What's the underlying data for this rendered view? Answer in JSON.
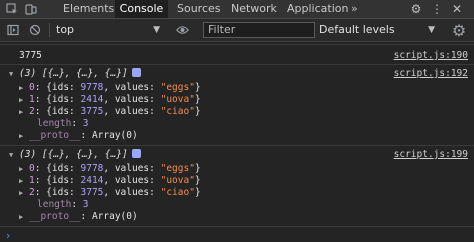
{
  "tabs": [
    "Elements",
    "Console",
    "Sources",
    "Network",
    "Application"
  ],
  "active_tab": "Console",
  "more_tabs_glyph": "»",
  "toolbar": {
    "context": "top",
    "filter_placeholder": "Filter",
    "levels": "Default levels"
  },
  "console": {
    "value_line": "3775",
    "value_source": "script.js:190",
    "groups": [
      {
        "summary": "(3) [{…}, {…}, {…}]",
        "source": "script.js:192",
        "items": [
          {
            "index": "0",
            "ids": "9778",
            "values": "\"eggs\""
          },
          {
            "index": "1",
            "ids": "2414",
            "values": "\"uova\""
          },
          {
            "index": "2",
            "ids": "3775",
            "values": "\"ciao\""
          }
        ],
        "length_key": "length",
        "length_val": "3",
        "proto_key": "__proto__",
        "proto_val": "Array(0)"
      },
      {
        "summary": "(3) [{…}, {…}, {…}]",
        "source": "script.js:199",
        "items": [
          {
            "index": "0",
            "ids": "9778",
            "values": "\"eggs\""
          },
          {
            "index": "1",
            "ids": "2414",
            "values": "\"uova\""
          },
          {
            "index": "2",
            "ids": "3775",
            "values": "\"ciao\""
          }
        ],
        "length_key": "length",
        "length_val": "3",
        "proto_key": "__proto__",
        "proto_val": "Array(0)"
      }
    ],
    "prompt": "›"
  },
  "colors": {
    "key": "#d59bdf",
    "number": "#a8a3ff",
    "string": "#f28b54",
    "badge": "#9aa7ff"
  }
}
